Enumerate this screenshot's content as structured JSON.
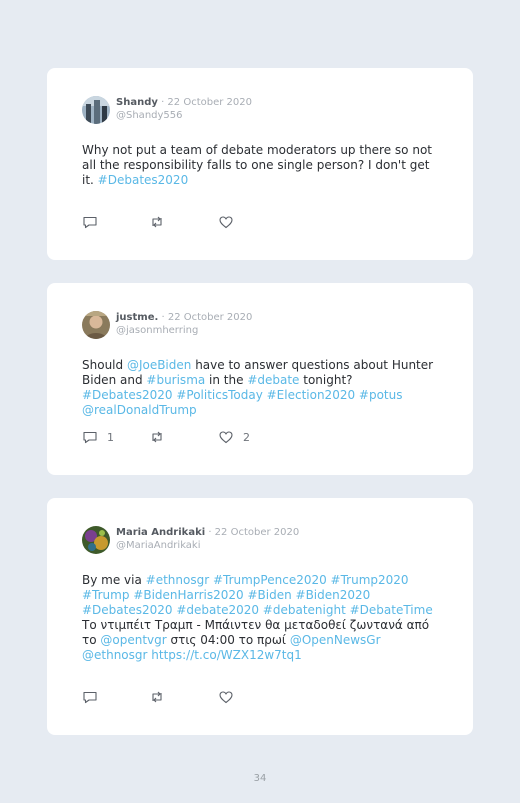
{
  "tweets": [
    {
      "name": "Shandy",
      "date": "· 22 October 2020",
      "handle": "@Shandy556",
      "text": [
        {
          "t": "Why not put a team of debate moderators up there so not all the responsibility falls to one single person? I don't get it. ",
          "link": false
        },
        {
          "t": "#Debates2020",
          "link": true
        }
      ],
      "reply_count": "",
      "retweet_count": "",
      "like_count": ""
    },
    {
      "name": "justme.",
      "date": "· 22 October 2020",
      "handle": "@jasonmherring",
      "text": [
        {
          "t": "Should ",
          "link": false
        },
        {
          "t": "@JoeBiden",
          "link": true
        },
        {
          "t": " have to answer questions about Hunter Biden and ",
          "link": false
        },
        {
          "t": "#burisma",
          "link": true
        },
        {
          "t": " in the ",
          "link": false
        },
        {
          "t": "#debate",
          "link": true
        },
        {
          "t": " tonight? ",
          "link": false
        },
        {
          "t": "#Debates2020 #PoliticsToday #Election2020 #potus @realDonaldTrump",
          "link": true
        }
      ],
      "reply_count": "1",
      "retweet_count": "",
      "like_count": "2"
    },
    {
      "name": "Maria Andrikaki",
      "date": "· 22 October 2020",
      "handle": "@MariaAndrikaki",
      "text": [
        {
          "t": "By me via ",
          "link": false
        },
        {
          "t": "#ethnosgr #TrumpPence2020 #Trump2020 #Trump #BidenHarris2020 #Biden #Biden2020 #Debates2020 #debate2020 #debatenight #DebateTime",
          "link": true
        },
        {
          "t": " Το ντιμπέιτ Τραμπ - Μπάιντεν θα μεταδοθεί ζωντανά από το ",
          "link": false
        },
        {
          "t": "@opentvgr",
          "link": true
        },
        {
          "t": " στις 04:00 το πρωί ",
          "link": false
        },
        {
          "t": "@OpenNewsGr @ethnosgr https://t.co/WZX12w7tq1",
          "link": true
        }
      ],
      "reply_count": "",
      "retweet_count": "",
      "like_count": ""
    }
  ],
  "page_number": "34",
  "colors": {
    "link": "#5ab8e6",
    "background": "#e6ebf2",
    "card": "#ffffff"
  }
}
